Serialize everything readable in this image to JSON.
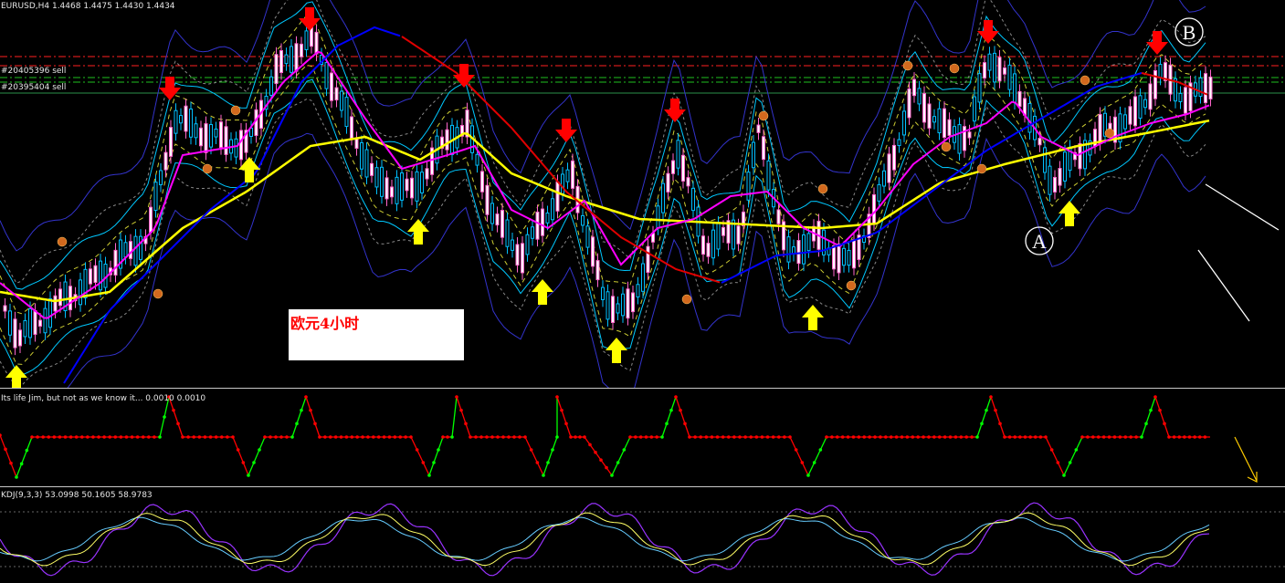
{
  "main": {
    "header": "EURUSD,H4  1.4468 1.4475 1.4430 1.4434",
    "order_labels": [
      "#20405396 sell",
      "#20395404 sell"
    ],
    "annotation": "欧元4小时",
    "point_labels": [
      "A",
      "B"
    ]
  },
  "indicator1": {
    "header": "Its life Jim, but not as we know it...  0.0010 0.0010"
  },
  "indicator2": {
    "header": "KDJ(9,3,3) 53.0998 50.1605 58.9783"
  },
  "colors": {
    "background": "#000000",
    "bull_candle": "#00bfff",
    "bear_candle": "#ffffff",
    "ma_fast": "#ff00ff",
    "ma_slow": "#ffff00",
    "ma_blue": "#0000ff",
    "ma_red": "#e00000",
    "band_outer": "#3333cc",
    "band_inner": "#00c8ff",
    "signal_up": "#ffff00",
    "signal_down": "#ff0000",
    "osc_green": "#00ff00",
    "osc_red": "#ff0000",
    "kdj_k": "#ffff66",
    "kdj_d": "#66ccff",
    "kdj_j": "#9933ff"
  }
}
